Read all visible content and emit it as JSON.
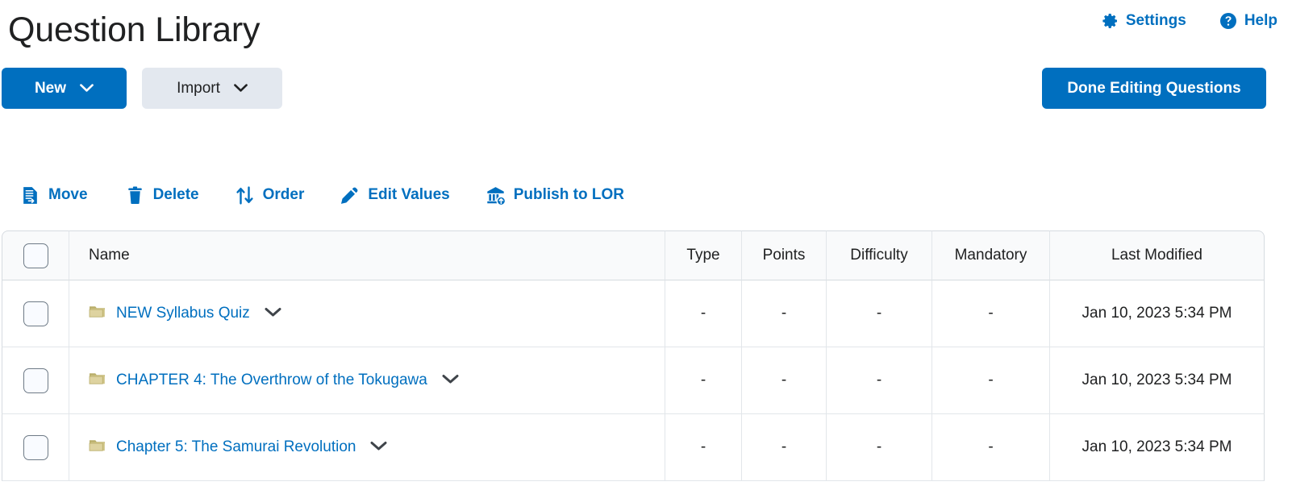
{
  "header": {
    "title": "Question Library",
    "actions": [
      {
        "label": "Settings",
        "icon": "gear-icon"
      },
      {
        "label": "Help",
        "icon": "question-circle-icon"
      }
    ]
  },
  "buttons": {
    "new_label": "New",
    "import_label": "Import",
    "done_label": "Done Editing Questions"
  },
  "toolbar": {
    "items": [
      {
        "label": "Move",
        "icon": "move-document-icon"
      },
      {
        "label": "Delete",
        "icon": "trash-icon"
      },
      {
        "label": "Order",
        "icon": "sort-arrows-icon"
      },
      {
        "label": "Edit Values",
        "icon": "pencil-icon"
      },
      {
        "label": "Publish to LOR",
        "icon": "bank-upload-icon"
      }
    ]
  },
  "table": {
    "columns": [
      "",
      "Name",
      "Type",
      "Points",
      "Difficulty",
      "Mandatory",
      "Last Modified"
    ],
    "rows": [
      {
        "name": "NEW Syllabus Quiz",
        "icon": "folder-icon",
        "type": "-",
        "points": "-",
        "difficulty": "-",
        "mandatory": "-",
        "last_modified": "Jan 10, 2023 5:34 PM"
      },
      {
        "name": "CHAPTER 4: The Overthrow of the Tokugawa",
        "icon": "folder-icon",
        "type": "-",
        "points": "-",
        "difficulty": "-",
        "mandatory": "-",
        "last_modified": "Jan 10, 2023 5:34 PM"
      },
      {
        "name": "Chapter 5: The Samurai Revolution",
        "icon": "folder-icon",
        "type": "-",
        "points": "-",
        "difficulty": "-",
        "mandatory": "-",
        "last_modified": "Jan 10, 2023 5:34 PM"
      }
    ]
  },
  "colors": {
    "accent": "#006fbf",
    "secondary_button": "#e3e8ef",
    "folder": "#c8bd74",
    "text": "#202122",
    "header_bg": "#f9fafb"
  }
}
